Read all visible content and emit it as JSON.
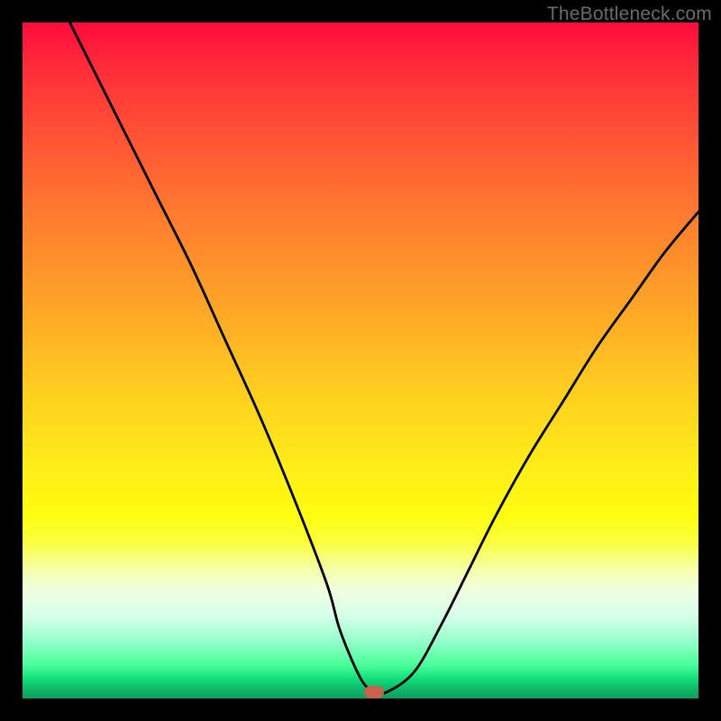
{
  "attribution": "TheBottleneck.com",
  "marker": {
    "x_pct": 52,
    "y_pct": 99
  },
  "chart_data": {
    "type": "line",
    "title": "",
    "xlabel": "",
    "ylabel": "",
    "xlim": [
      0,
      100
    ],
    "ylim": [
      0,
      100
    ],
    "grid": false,
    "legend": false,
    "annotations": [],
    "series": [
      {
        "name": "curve",
        "x": [
          7,
          10,
          15,
          20,
          25,
          30,
          35,
          40,
          45,
          47,
          50,
          52,
          54,
          58,
          62,
          66,
          70,
          75,
          80,
          85,
          90,
          95,
          100
        ],
        "y": [
          100,
          94,
          84,
          74,
          64,
          53,
          42,
          30,
          17,
          10,
          3,
          1,
          1,
          4,
          11,
          19,
          27,
          36,
          44,
          52,
          59,
          66,
          72
        ]
      }
    ],
    "background_gradient": {
      "top": "#ff0b3e",
      "middle": "#fff018",
      "bottom": "#0c9e5e"
    }
  }
}
